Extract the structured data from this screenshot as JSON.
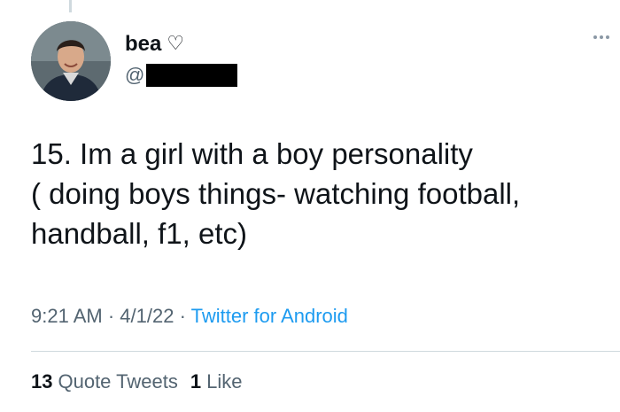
{
  "user": {
    "display_name": "bea",
    "name_emoji": "♡",
    "handle_prefix": "@"
  },
  "tweet": {
    "text": "15. Im a girl with a boy personality\n( doing boys things- watching football,\nhandball, f1, etc)"
  },
  "meta": {
    "time": "9:21 AM",
    "separator": " · ",
    "date": "4/1/22",
    "source": "Twitter for Android"
  },
  "stats": {
    "quote_tweets_count": "13",
    "quote_tweets_label": "Quote Tweets",
    "likes_count": "1",
    "likes_label": "Like"
  },
  "icons": {
    "more": "more-options-icon",
    "heart": "heart-outline-icon"
  },
  "colors": {
    "text_primary": "#0f1419",
    "text_secondary": "#536471",
    "link": "#1d9bf0",
    "divider": "#cfd9de"
  }
}
